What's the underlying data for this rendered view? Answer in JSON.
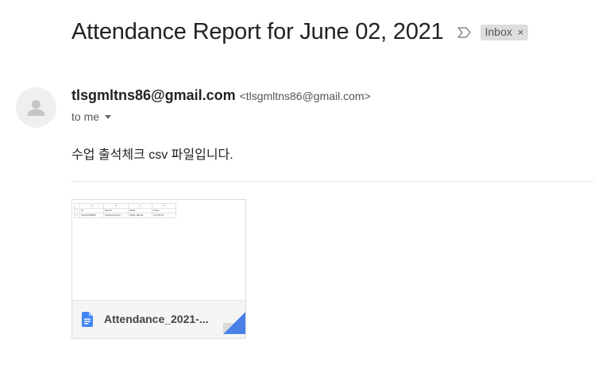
{
  "message": {
    "subject": "Attendance Report for June 02, 2021",
    "label": {
      "text": "Inbox",
      "remove_glyph": "×"
    },
    "important_icon": "importance-marker-icon",
    "sender": {
      "name": "tlsgmltns86@gmail.com",
      "email": "<tlsgmltns86@gmail.com>",
      "avatar_icon": "person-icon"
    },
    "recipient": "to me",
    "body": "수업 출석체크 csv 파일입니다."
  },
  "attachment": {
    "filename": "Attendance_2021-...",
    "file_icon": "google-docs-icon",
    "preview": {
      "column_letters": [
        "",
        "A",
        "B",
        "C",
        "D"
      ],
      "rows": [
        [
          "1",
          "Id",
          "Name",
          "Date",
          "Time"
        ],
        [
          "2",
          "2016310805",
          "shinjeehyunk",
          "2021-06-02",
          "14:33:47"
        ]
      ]
    }
  },
  "colors": {
    "doc_icon_blue": "#4285f4",
    "label_chip_bg": "#dddddd",
    "text_primary": "#222222",
    "text_secondary": "#555555"
  }
}
